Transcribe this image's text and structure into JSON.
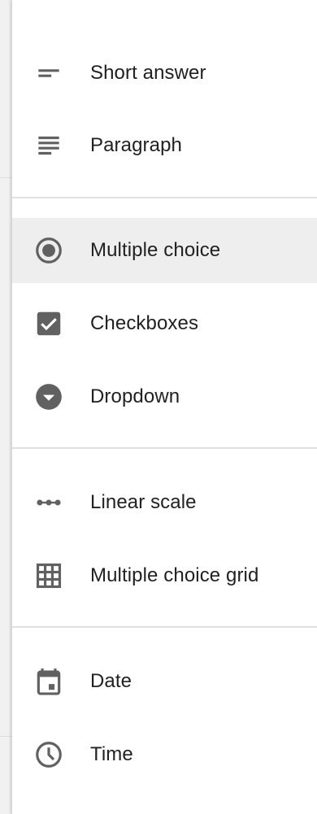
{
  "menu": {
    "groups": [
      {
        "items": [
          {
            "label": "Short answer",
            "icon": "short-text-icon"
          },
          {
            "label": "Paragraph",
            "icon": "paragraph-icon"
          }
        ]
      },
      {
        "items": [
          {
            "label": "Multiple choice",
            "icon": "radio-button-icon",
            "selected": true
          },
          {
            "label": "Checkboxes",
            "icon": "checkbox-icon"
          },
          {
            "label": "Dropdown",
            "icon": "dropdown-icon"
          }
        ]
      },
      {
        "items": [
          {
            "label": "Linear scale",
            "icon": "linear-scale-icon"
          },
          {
            "label": "Multiple choice grid",
            "icon": "grid-icon"
          }
        ]
      },
      {
        "items": [
          {
            "label": "Date",
            "icon": "calendar-icon"
          },
          {
            "label": "Time",
            "icon": "clock-icon"
          }
        ]
      }
    ]
  },
  "colors": {
    "icon": "#616161",
    "text": "#212121",
    "selected_bg": "#eeeeee",
    "divider": "#e0e0e0"
  }
}
